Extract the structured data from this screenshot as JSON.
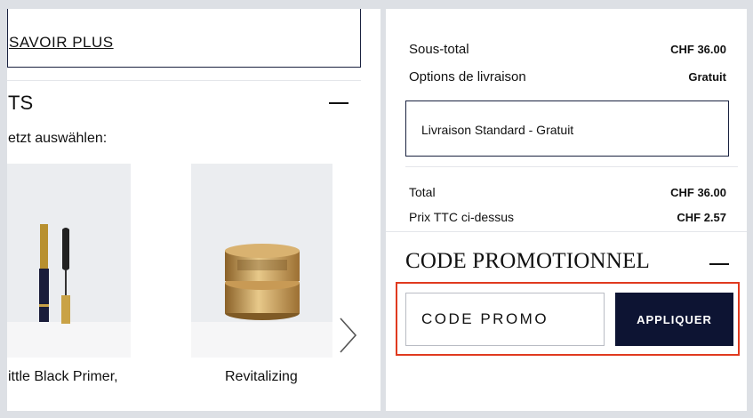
{
  "left": {
    "learn_more": "SAVOIR PLUS",
    "section_title": "TS",
    "collapse_icon": "minus-icon",
    "subtitle": "etzt auswählen:",
    "products": [
      {
        "name": "ittle Black Primer,",
        "image": "mascara-primer-image"
      },
      {
        "name": "Revitalizing",
        "image": "cream-jar-image"
      }
    ],
    "next_icon": "chevron-right-icon"
  },
  "summary": {
    "subtotal_label": "Sous-total",
    "subtotal_value": "CHF 36.00",
    "shipping_label": "Options de livraison",
    "shipping_value": "Gratuit",
    "shipping_selected": "Livraison Standard - Gratuit",
    "total_label": "Total",
    "total_value": "CHF 36.00",
    "tax_label": "Prix TTC ci-dessus",
    "tax_value": "CHF 2.57"
  },
  "promo": {
    "title": "CODE PROMOTIONNEL",
    "collapse_icon": "minus-icon",
    "placeholder": "CODE PROMO",
    "apply_label": "APPLIQUER"
  },
  "colors": {
    "navy": "#0d1433",
    "highlight": "#e03a1f",
    "page_bg": "#dde0e5"
  }
}
